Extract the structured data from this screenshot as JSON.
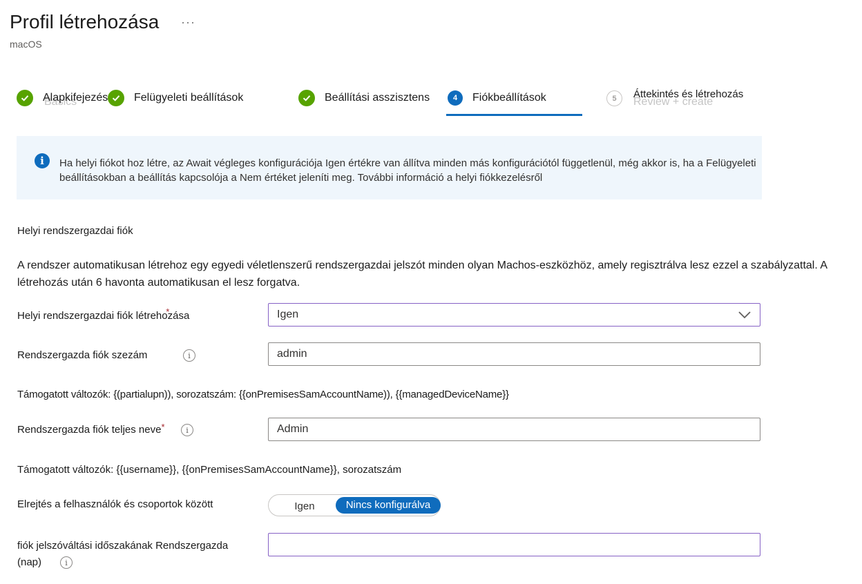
{
  "header": {
    "title": "Profil létrehozása",
    "dots": "···",
    "subtitle": "macOS"
  },
  "wizard": {
    "steps": [
      {
        "label": "Alapkifejezések",
        "status": "complete"
      },
      {
        "label": "Felügyeleti beállítások",
        "status": "complete"
      },
      {
        "label": "Beállítási asszisztens",
        "status": "complete"
      },
      {
        "label": "Fiókbeállítások",
        "status": "active",
        "number": "4"
      },
      {
        "label": "Áttekintés és létrehozás",
        "status": "pending",
        "number": "5"
      }
    ],
    "ghost_texts": [
      "Basics",
      "Review + create"
    ]
  },
  "info_banner": {
    "icon": "info-icon",
    "text": "Ha helyi fiókot hoz létre, az Await végleges konfigurációja Igen értékre van állítva minden más konfigurációtól függetlenül, még akkor is, ha a Felügyeleti beállításokban a beállítás kapcsolója a Nem értéket jeleníti meg. További információ a helyi fiókkezelésről"
  },
  "section": {
    "title": "Helyi rendszergazdai fiók",
    "description": "A rendszer automatikusan létrehoz egy egyedi véletlenszerű rendszergazdai jelszót minden olyan Machos-eszközhöz, amely regisztrálva lesz ezzel a szabályzattal. A létrehozás után 6 havonta automatikusan el lesz forgatva."
  },
  "form": {
    "create_local_admin": {
      "label": "Helyi rendszergazdai fiók létrehozása",
      "required_mark": "*",
      "value": "Igen"
    },
    "admin_short_name": {
      "label": "Rendszergazda fiók szezám",
      "value": "admin",
      "helper": "Támogatott változók: {(partialupn)), sorozatszám: {{onPremisesSamAccountName)), {{managedDeviceName}}"
    },
    "admin_full_name": {
      "label": "Rendszergazda fiók teljes neve",
      "required_mark": "*",
      "value": "Admin",
      "helper": "Támogatott változók: {{username}}, {{onPremisesSamAccountName}}, sorozatszám"
    },
    "hide_users": {
      "label": "Elrejtés a felhasználók és csoportok között",
      "option_yes": "Igen",
      "option_selected": "Nincs konfigurálva"
    },
    "password_rotation": {
      "label_line1": "fiók jelszóváltási időszakának Rendszergazda",
      "label_line2": "(nap)",
      "value": ""
    }
  },
  "colors": {
    "accent": "#0f6cbd",
    "success": "#57a300",
    "focus_border": "#8661c5",
    "banner_bg": "#eff6fc"
  }
}
